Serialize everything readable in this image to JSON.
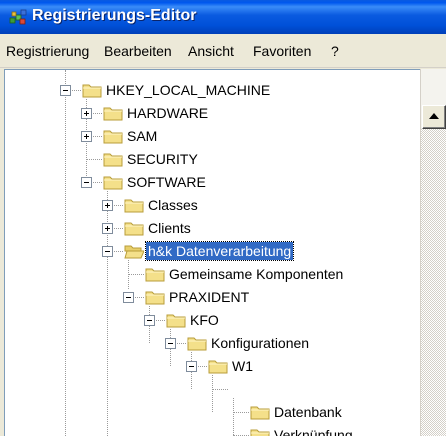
{
  "window": {
    "title": "Registrierungs-Editor",
    "title_icon": "registry-editor-icon"
  },
  "menu": {
    "items": [
      "Registrierung",
      "Bearbeiten",
      "Ansicht",
      "Favoriten",
      "?"
    ]
  },
  "tree": {
    "folder_color": "#f4e08a",
    "selection_color": "#316ac5",
    "nodes": [
      {
        "label": "HKEY_LOCAL_MACHINE",
        "expander": "-"
      },
      {
        "label": "HARDWARE",
        "expander": "+"
      },
      {
        "label": "SAM",
        "expander": "+"
      },
      {
        "label": "SECURITY",
        "expander": ""
      },
      {
        "label": "SOFTWARE",
        "expander": "-"
      },
      {
        "label": "Classes",
        "expander": "+"
      },
      {
        "label": "Clients",
        "expander": "+"
      },
      {
        "label": "h&k Datenverarbeitung",
        "expander": "-",
        "selected": true
      },
      {
        "label": "Gemeinsame Komponenten",
        "expander": ""
      },
      {
        "label": "PRAXIDENT",
        "expander": "-"
      },
      {
        "label": "KFO",
        "expander": "-"
      },
      {
        "label": "Konfigurationen",
        "expander": "-"
      },
      {
        "label": "W1",
        "expander": "-"
      },
      {
        "label": "Datenbank",
        "expander": ""
      },
      {
        "label": "Verknüpfung",
        "expander": ""
      }
    ]
  }
}
